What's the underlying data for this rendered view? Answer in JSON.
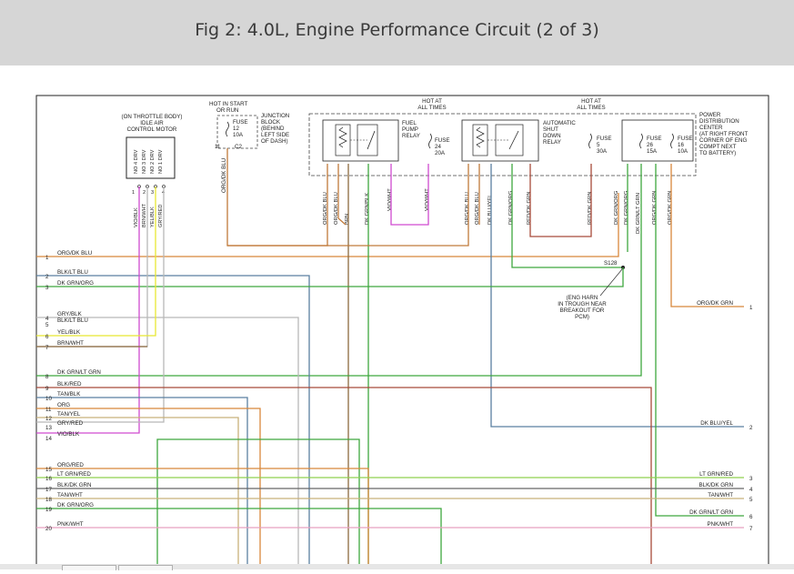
{
  "header": {
    "title": "Fig 2: 4.0L, Engine Performance Circuit (2 of 3)"
  },
  "labels": {
    "iac_loc": "(ON THROTTLE BODY)",
    "iac_name1": "IDLE AIR",
    "iac_name2": "CONTROL MOTOR",
    "iac_pins": [
      "NO 4 DRV",
      "NO 3 DRV",
      "NO 2 DRV",
      "NO 1 DRV"
    ],
    "iac_pin_nums": [
      "1",
      "2",
      "3",
      "4"
    ],
    "iac_wires": [
      "VIO/BLK",
      "BRN/WHT",
      "YEL/BLK",
      "GRY/RED"
    ],
    "hot_start1": "HOT IN START",
    "hot_start2": "OR RUN",
    "jb_fuse": [
      "FUSE",
      "12",
      "10A"
    ],
    "jb_pin": "11",
    "jb_conn": "C2",
    "jb_name": [
      "JUNCTION",
      "BLOCK",
      "(BEHIND",
      "LEFT SIDE",
      "OF DASH)"
    ],
    "jb_wire": "ORG/DK BLU",
    "hot_all1": "HOT AT",
    "hot_all2": "ALL TIMES",
    "fp_relay": [
      "FUEL",
      "PUMP",
      "RELAY"
    ],
    "fuse24": [
      "FUSE",
      "24",
      "20A"
    ],
    "asd_relay": [
      "AUTOMATIC",
      "SHUT",
      "DOWN",
      "RELAY"
    ],
    "fuse5": [
      "FUSE",
      "5",
      "30A"
    ],
    "fuse26": [
      "FUSE",
      "26",
      "15A"
    ],
    "fuse16": [
      "FUSE",
      "16",
      "10A"
    ],
    "pdc": [
      "POWER",
      "DISTRIBUTION",
      "CENTER",
      "(AT RIGHT FRONT",
      "CORNER OF ENG",
      "COMPT NEXT",
      "TO BATTERY)"
    ],
    "relay_wires": [
      "ORG/DK BLU",
      "ORG/DK BLU",
      "BRN",
      "DK GRN/BLK",
      "VIO/WHT",
      "VIO/WHT",
      "ORG/DK BLU",
      "ORG/DK BLU",
      "DK BLU/YEL",
      "DK GRN/ORG",
      "RED/DK GRN",
      "RED/DK GRN",
      "DK GRN/ORG",
      "DK GRN/ORG",
      "DK GRN/LT GRN",
      "ORG/DK GRN",
      "ORG/DK GRN"
    ],
    "splice": "S128",
    "splice_note": [
      "(ENG HARN",
      "IN TROUGH NEAR",
      "BREAKOUT FOR",
      "PCM)"
    ]
  },
  "left_rows": [
    {
      "num": "1",
      "label": "ORG/DK BLU"
    },
    {
      "num": "2",
      "label": "BLK/LT BLU"
    },
    {
      "num": "3",
      "label": "DK GRN/ORG"
    },
    {
      "num": "4",
      "label": "GRY/BLK"
    },
    {
      "num": "5",
      "label": "BLK/LT BLU"
    },
    {
      "num": "6",
      "label": "YEL/BLK"
    },
    {
      "num": "7",
      "label": "BRN/WHT"
    },
    {
      "num": "8",
      "label": "DK GRN/LT GRN"
    },
    {
      "num": "9",
      "label": "BLK/RED"
    },
    {
      "num": "10",
      "label": "TAN/BLK"
    },
    {
      "num": "11",
      "label": "ORG"
    },
    {
      "num": "12",
      "label": "TAN/YEL"
    },
    {
      "num": "13",
      "label": "GRY/RED"
    },
    {
      "num": "14",
      "label": "VIO/BLK"
    },
    {
      "num": "15",
      "label": "ORG/RED"
    },
    {
      "num": "16",
      "label": "LT GRN/RED"
    },
    {
      "num": "17",
      "label": "BLK/DK GRN"
    },
    {
      "num": "18",
      "label": "TAN/WHT"
    },
    {
      "num": "19",
      "label": "DK GRN/ORG"
    },
    {
      "num": "20",
      "label": "PNK/WHT"
    }
  ],
  "right_rows": [
    {
      "num": "1",
      "label": "ORG/DK GRN"
    },
    {
      "num": "2",
      "label": "DK BLU/YEL"
    },
    {
      "num": "3",
      "label": "LT GRN/RED"
    },
    {
      "num": "4",
      "label": "BLK/DK GRN"
    },
    {
      "num": "5",
      "label": "TAN/WHT"
    },
    {
      "num": "6",
      "label": "DK GRN/LT GRN"
    },
    {
      "num": "7",
      "label": "PNK/WHT"
    }
  ],
  "colors": {
    "header_bg": "#d6d6d6",
    "orange": "#d8873b",
    "brown": "#8b6a3e",
    "green": "#3ea83e",
    "light_green": "#8fd14f",
    "violet": "#d04bd0",
    "yellow": "#e8e832",
    "gray": "#b8b8b8",
    "blue": "#5a7fa0",
    "tan": "#c8b07a",
    "red": "#a84a3a",
    "pink": "#e8a0c0"
  }
}
